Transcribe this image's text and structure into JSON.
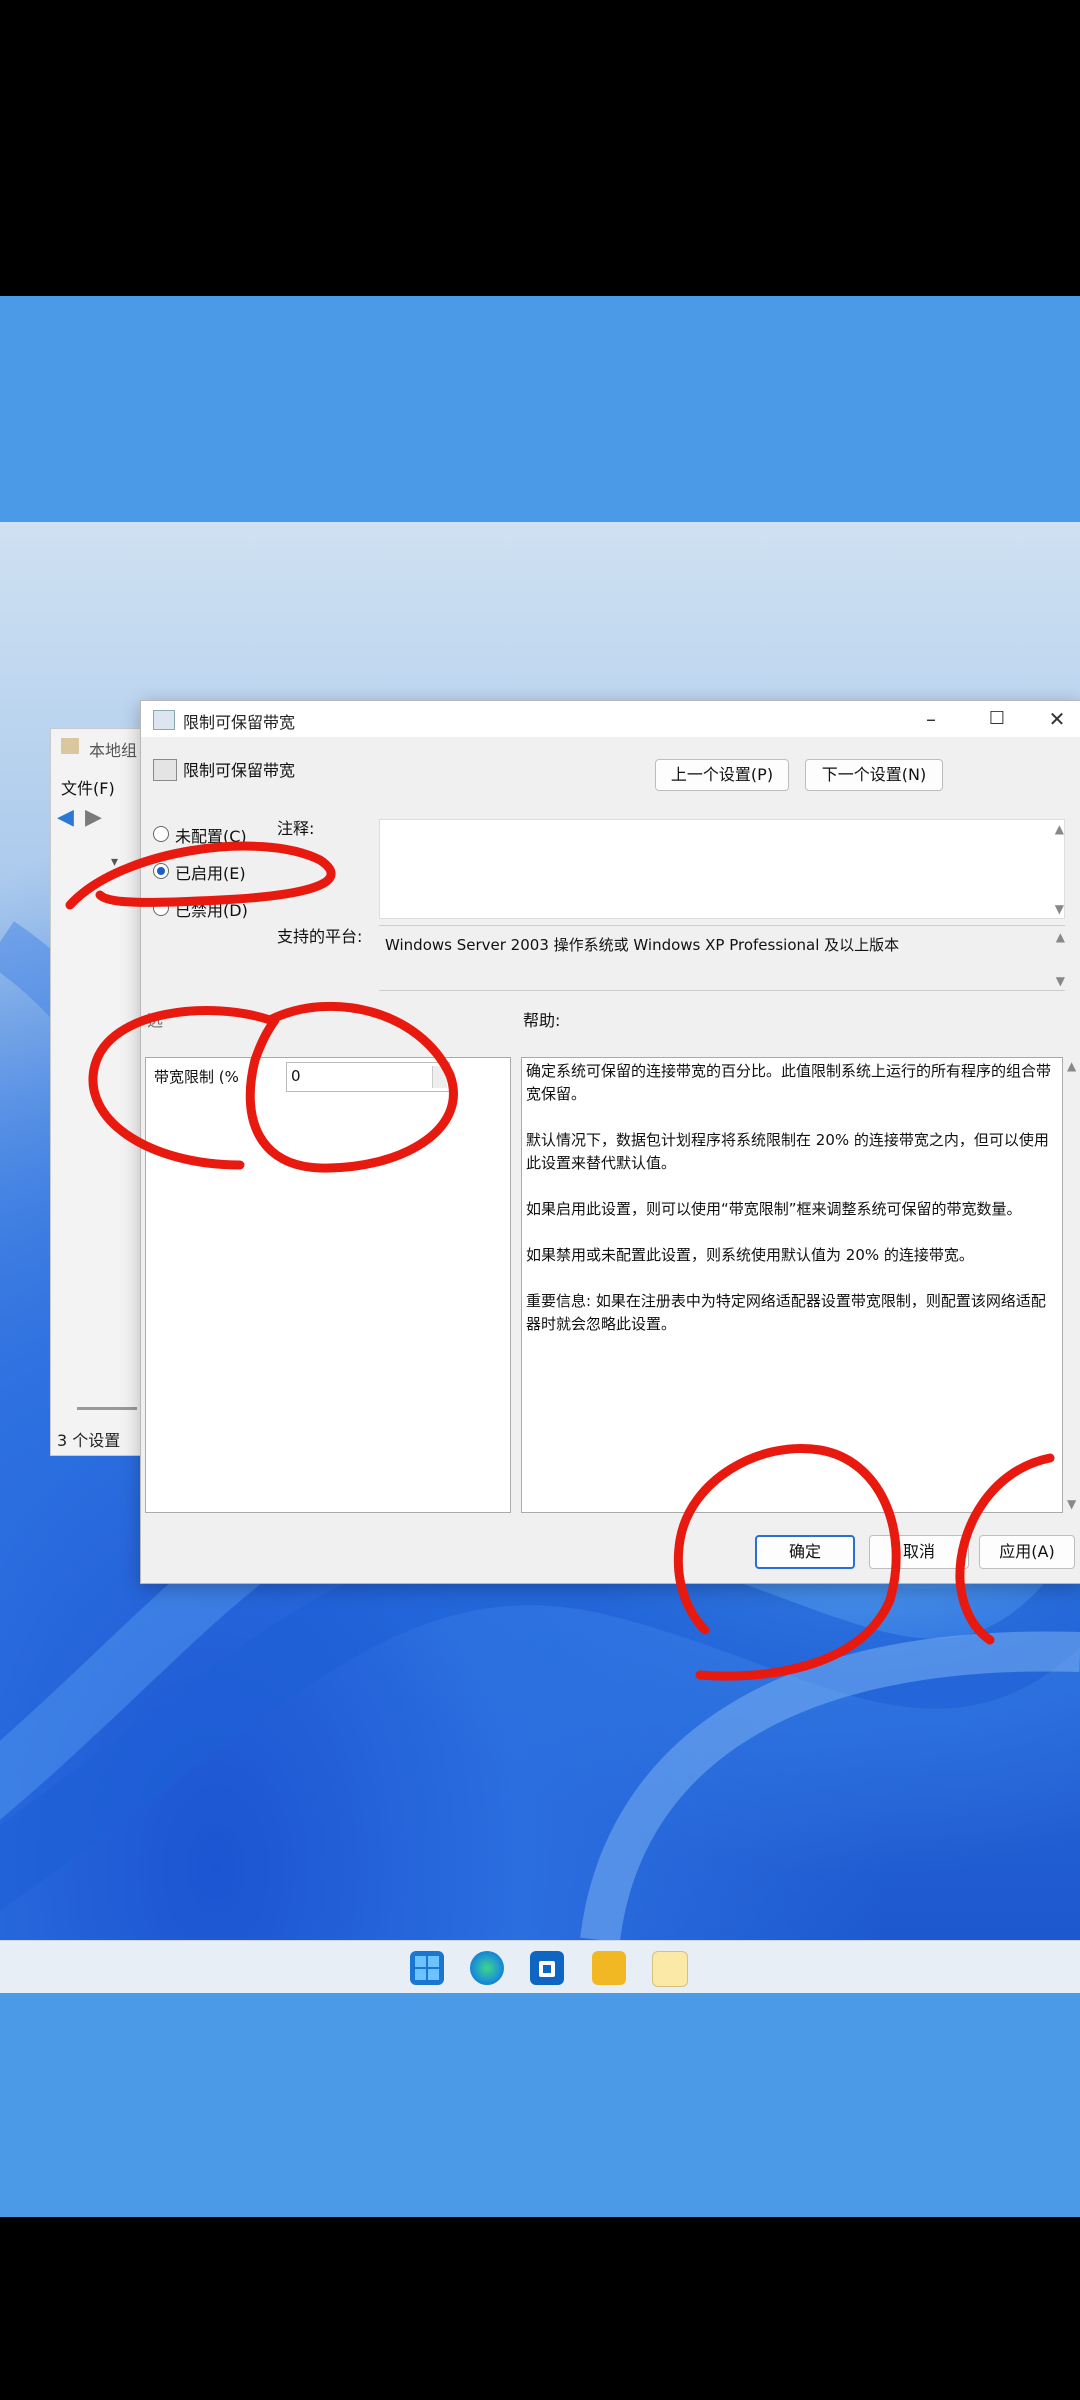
{
  "background_window": {
    "title": "本地组",
    "menu_file": "文件(F)",
    "status": "3 个设置"
  },
  "dialog": {
    "title": "限制可保留带宽",
    "header_title": "限制可保留带宽",
    "prev_button": "上一个设置(P)",
    "next_button": "下一个设置(N)",
    "radio_not_configured": "未配置(C)",
    "radio_enabled": "已启用(E)",
    "radio_disabled": "已禁用(D)",
    "note_label": "注释:",
    "platform_label": "支持的平台:",
    "platform_value": "Windows Server 2003 操作系统或 Windows XP Professional 及以上版本",
    "options_label": "选",
    "help_label": "帮助:",
    "bandwidth_label": "带宽限制 (%",
    "bandwidth_value": "0",
    "help_text": "确定系统可保留的连接带宽的百分比。此值限制系统上运行的所有程序的组合带宽保留。\n\n默认情况下，数据包计划程序将系统限制在 20% 的连接带宽之内，但可以使用此设置来替代默认值。\n\n如果启用此设置，则可以使用“带宽限制”框来调整系统可保留的带宽数量。\n\n如果禁用或未配置此设置，则系统使用默认值为 20% 的连接带宽。\n\n重要信息: 如果在注册表中为特定网络适配器设置带宽限制，则配置该网络适配器时就会忽略此设置。",
    "ok_button": "确定",
    "cancel_button": "取消",
    "apply_button": "应用(A)"
  },
  "colors": {
    "annotation": "#e8190f",
    "accent": "#2a6fd6"
  }
}
